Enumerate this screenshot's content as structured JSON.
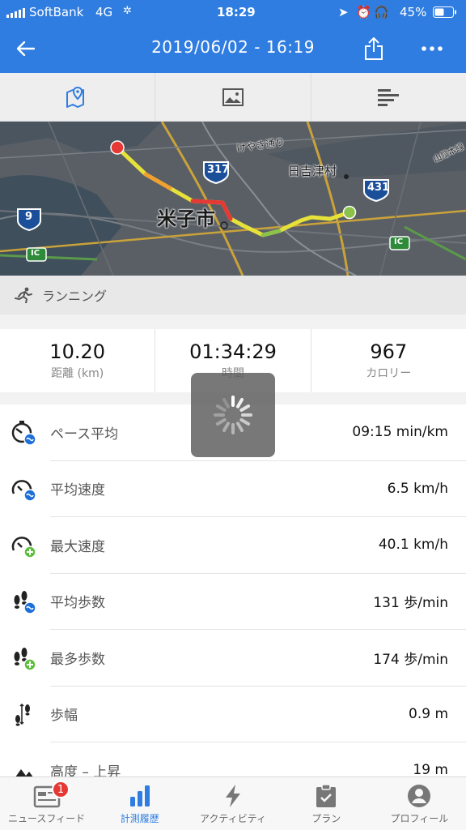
{
  "status_bar": {
    "carrier": "SoftBank",
    "network": "4G",
    "time": "18:29",
    "battery": "45%"
  },
  "nav": {
    "title": "2019/06/02 - 16:19",
    "back_icon": "arrow-left-icon",
    "share_icon": "share-icon",
    "more_icon": "more-icon"
  },
  "view_tabs": [
    {
      "icon": "map-icon",
      "active": true
    },
    {
      "icon": "image-icon",
      "active": false
    },
    {
      "icon": "bar-list-icon",
      "active": false
    }
  ],
  "map": {
    "city_label": "米子市",
    "labels": [
      "けやき通り",
      "日吉津村",
      "山陰本線"
    ],
    "route_numbers": [
      "317",
      "431",
      "9"
    ],
    "ic_labels": [
      "IC",
      "IC"
    ],
    "start_color": "#8bc34a",
    "end_color": "#e53935"
  },
  "activity": {
    "type": "ランニング",
    "icon": "running-icon"
  },
  "summary": [
    {
      "value": "10.20",
      "label": "距離 (km)"
    },
    {
      "value": "01:34:29",
      "label": "時間"
    },
    {
      "value": "967",
      "label": "カロリー"
    }
  ],
  "stats": [
    {
      "icon": "stopwatch-avg-icon",
      "label": "ペース平均",
      "value": "09:15 min/km"
    },
    {
      "icon": "speedometer-avg-icon",
      "label": "平均速度",
      "value": "6.5 km/h"
    },
    {
      "icon": "speedometer-max-icon",
      "label": "最大速度",
      "value": "40.1 km/h"
    },
    {
      "icon": "footsteps-avg-icon",
      "label": "平均歩数",
      "value": "131 歩/min"
    },
    {
      "icon": "footsteps-max-icon",
      "label": "最多歩数",
      "value": "174 歩/min"
    },
    {
      "icon": "stride-icon",
      "label": "歩幅",
      "value": "0.9 m"
    },
    {
      "icon": "elevation-icon",
      "label": "高度 – 上昇",
      "value": "19 m"
    }
  ],
  "tab_bar": [
    {
      "label": "ニュースフィード",
      "icon": "newsfeed-icon",
      "badge": "1",
      "active": false
    },
    {
      "label": "計測履歴",
      "icon": "history-chart-icon",
      "active": true
    },
    {
      "label": "アクティビティ",
      "icon": "lightning-icon",
      "active": false
    },
    {
      "label": "プラン",
      "icon": "clipboard-check-icon",
      "active": false
    },
    {
      "label": "プロフィール",
      "icon": "profile-icon",
      "active": false
    }
  ],
  "colors": {
    "accent": "#2f7de1",
    "badge": "#e53935",
    "icon_blue": "#1e6fd9",
    "icon_green": "#5cbf3a"
  }
}
